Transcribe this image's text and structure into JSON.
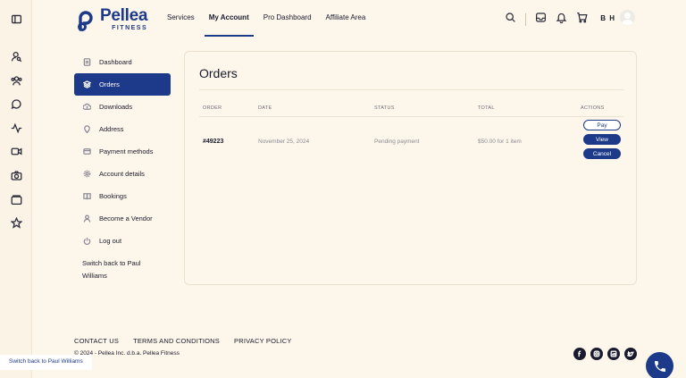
{
  "brand": {
    "name": "Pellea",
    "sub": "FITNESS",
    "color": "#1d3a8a"
  },
  "nav": [
    "Services",
    "My Account",
    "Pro Dashboard",
    "Affiliate Area"
  ],
  "nav_active": "My Account",
  "user": {
    "initials": "B H"
  },
  "rail_icons": [
    "sidebar-toggle-icon",
    "user-search-icon",
    "users-icon",
    "chat-icon",
    "activity-icon",
    "video-icon",
    "camera-icon",
    "folder-icon",
    "star-icon"
  ],
  "header_icons": [
    "search-icon",
    "inbox-icon",
    "bell-icon",
    "cart-icon"
  ],
  "sidebar": {
    "items": [
      {
        "label": "Dashboard",
        "icon": "dashboard-icon"
      },
      {
        "label": "Orders",
        "icon": "orders-icon",
        "active": true
      },
      {
        "label": "Downloads",
        "icon": "download-icon"
      },
      {
        "label": "Address",
        "icon": "location-icon"
      },
      {
        "label": "Payment methods",
        "icon": "card-icon"
      },
      {
        "label": "Account details",
        "icon": "settings-icon"
      },
      {
        "label": "Bookings",
        "icon": "book-icon"
      },
      {
        "label": "Become a Vendor",
        "icon": "user-icon"
      },
      {
        "label": "Log out",
        "icon": "power-icon"
      }
    ],
    "switch_back": "Switch back to Paul Williams"
  },
  "orders": {
    "title": "Orders",
    "columns": [
      "ORDER",
      "DATE",
      "STATUS",
      "TOTAL",
      "ACTIONS"
    ],
    "rows": [
      {
        "order": "#49223",
        "date": "November 25, 2024",
        "status": "Pending payment",
        "total": "$50.00 for 1 item",
        "actions": [
          "Pay",
          "View",
          "Cancel"
        ]
      }
    ]
  },
  "footer": {
    "links": [
      "CONTACT US",
      "TERMS AND CONDITIONS",
      "PRIVACY POLICY"
    ],
    "copyright": "© 2024 - Pellea Inc. d.b.a. Pellea Fitness",
    "social": [
      "facebook-icon",
      "instagram-icon",
      "linkedin-icon",
      "twitter-icon"
    ]
  },
  "switch_bar": "Switch back to Paul Williams"
}
